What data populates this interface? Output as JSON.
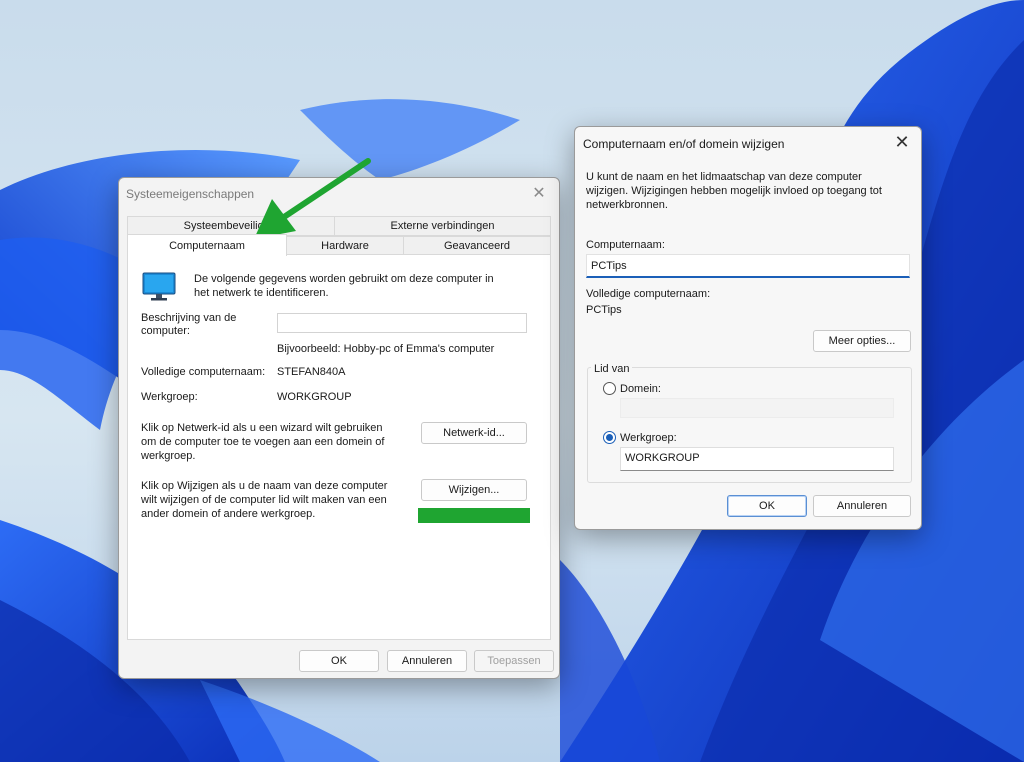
{
  "system_properties": {
    "title": "Systeemeigenschappen",
    "tabs_row1": [
      "Systeembeveiliging",
      "Externe verbindingen"
    ],
    "tabs_row2": [
      "Computernaam",
      "Hardware",
      "Geavanceerd"
    ],
    "info_text_1": "De volgende gegevens worden gebruikt om deze computer in",
    "info_text_2": "het netwerk te identificeren.",
    "description_label_1": "Beschrijving van de",
    "description_label_2": "computer:",
    "description_value": "",
    "example_text": "Bijvoorbeeld: Hobby-pc of Emma's computer",
    "full_name_label": "Volledige computernaam:",
    "full_name_value": "STEFAN840A",
    "workgroup_label": "Werkgroep:",
    "workgroup_value": "WORKGROUP",
    "netid_text_1": "Klik op Netwerk-id als u een wizard wilt gebruiken",
    "netid_text_2": "om de computer toe te voegen aan een domein of",
    "netid_text_3": "werkgroep.",
    "netid_button": "Netwerk-id...",
    "change_text_1": "Klik op Wijzigen als u de naam van deze computer",
    "change_text_2": "wilt wijzigen of de computer lid wilt maken van een",
    "change_text_3": "ander domein of andere werkgroep.",
    "change_button": "Wijzigen...",
    "ok_button": "OK",
    "cancel_button": "Annuleren",
    "apply_button": "Toepassen"
  },
  "computer_name_dialog": {
    "title": "Computernaam en/of domein wijzigen",
    "intro_1": "U kunt de naam en het lidmaatschap van deze computer",
    "intro_2": "wijzigen. Wijzigingen hebben mogelijk invloed op toegang tot",
    "intro_3": "netwerkbronnen.",
    "name_label": "Computernaam:",
    "name_value": "PCTips",
    "full_name_label": "Volledige computernaam:",
    "full_name_value": "PCTips",
    "more_button": "Meer opties...",
    "member_of_label": "Lid van",
    "domain_label": "Domein:",
    "domain_value": "",
    "workgroup_label": "Werkgroep:",
    "workgroup_value": "WORKGROUP",
    "ok_button": "OK",
    "cancel_button": "Annuleren"
  },
  "colors": {
    "annotation_green": "#1fa531",
    "wallpaper_blue": "#1d4fe0"
  }
}
